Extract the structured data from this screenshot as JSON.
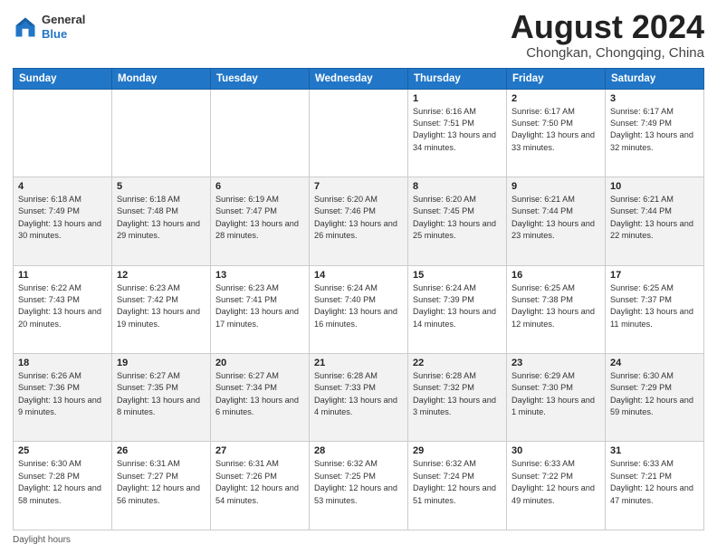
{
  "header": {
    "logo_general": "General",
    "logo_blue": "Blue",
    "month_title": "August 2024",
    "location": "Chongkan, Chongqing, China"
  },
  "days_of_week": [
    "Sunday",
    "Monday",
    "Tuesday",
    "Wednesday",
    "Thursday",
    "Friday",
    "Saturday"
  ],
  "weeks": [
    [
      {
        "day": "",
        "info": ""
      },
      {
        "day": "",
        "info": ""
      },
      {
        "day": "",
        "info": ""
      },
      {
        "day": "",
        "info": ""
      },
      {
        "day": "1",
        "info": "Sunrise: 6:16 AM\nSunset: 7:51 PM\nDaylight: 13 hours and 34 minutes."
      },
      {
        "day": "2",
        "info": "Sunrise: 6:17 AM\nSunset: 7:50 PM\nDaylight: 13 hours and 33 minutes."
      },
      {
        "day": "3",
        "info": "Sunrise: 6:17 AM\nSunset: 7:49 PM\nDaylight: 13 hours and 32 minutes."
      }
    ],
    [
      {
        "day": "4",
        "info": "Sunrise: 6:18 AM\nSunset: 7:49 PM\nDaylight: 13 hours and 30 minutes."
      },
      {
        "day": "5",
        "info": "Sunrise: 6:18 AM\nSunset: 7:48 PM\nDaylight: 13 hours and 29 minutes."
      },
      {
        "day": "6",
        "info": "Sunrise: 6:19 AM\nSunset: 7:47 PM\nDaylight: 13 hours and 28 minutes."
      },
      {
        "day": "7",
        "info": "Sunrise: 6:20 AM\nSunset: 7:46 PM\nDaylight: 13 hours and 26 minutes."
      },
      {
        "day": "8",
        "info": "Sunrise: 6:20 AM\nSunset: 7:45 PM\nDaylight: 13 hours and 25 minutes."
      },
      {
        "day": "9",
        "info": "Sunrise: 6:21 AM\nSunset: 7:44 PM\nDaylight: 13 hours and 23 minutes."
      },
      {
        "day": "10",
        "info": "Sunrise: 6:21 AM\nSunset: 7:44 PM\nDaylight: 13 hours and 22 minutes."
      }
    ],
    [
      {
        "day": "11",
        "info": "Sunrise: 6:22 AM\nSunset: 7:43 PM\nDaylight: 13 hours and 20 minutes."
      },
      {
        "day": "12",
        "info": "Sunrise: 6:23 AM\nSunset: 7:42 PM\nDaylight: 13 hours and 19 minutes."
      },
      {
        "day": "13",
        "info": "Sunrise: 6:23 AM\nSunset: 7:41 PM\nDaylight: 13 hours and 17 minutes."
      },
      {
        "day": "14",
        "info": "Sunrise: 6:24 AM\nSunset: 7:40 PM\nDaylight: 13 hours and 16 minutes."
      },
      {
        "day": "15",
        "info": "Sunrise: 6:24 AM\nSunset: 7:39 PM\nDaylight: 13 hours and 14 minutes."
      },
      {
        "day": "16",
        "info": "Sunrise: 6:25 AM\nSunset: 7:38 PM\nDaylight: 13 hours and 12 minutes."
      },
      {
        "day": "17",
        "info": "Sunrise: 6:25 AM\nSunset: 7:37 PM\nDaylight: 13 hours and 11 minutes."
      }
    ],
    [
      {
        "day": "18",
        "info": "Sunrise: 6:26 AM\nSunset: 7:36 PM\nDaylight: 13 hours and 9 minutes."
      },
      {
        "day": "19",
        "info": "Sunrise: 6:27 AM\nSunset: 7:35 PM\nDaylight: 13 hours and 8 minutes."
      },
      {
        "day": "20",
        "info": "Sunrise: 6:27 AM\nSunset: 7:34 PM\nDaylight: 13 hours and 6 minutes."
      },
      {
        "day": "21",
        "info": "Sunrise: 6:28 AM\nSunset: 7:33 PM\nDaylight: 13 hours and 4 minutes."
      },
      {
        "day": "22",
        "info": "Sunrise: 6:28 AM\nSunset: 7:32 PM\nDaylight: 13 hours and 3 minutes."
      },
      {
        "day": "23",
        "info": "Sunrise: 6:29 AM\nSunset: 7:30 PM\nDaylight: 13 hours and 1 minute."
      },
      {
        "day": "24",
        "info": "Sunrise: 6:30 AM\nSunset: 7:29 PM\nDaylight: 12 hours and 59 minutes."
      }
    ],
    [
      {
        "day": "25",
        "info": "Sunrise: 6:30 AM\nSunset: 7:28 PM\nDaylight: 12 hours and 58 minutes."
      },
      {
        "day": "26",
        "info": "Sunrise: 6:31 AM\nSunset: 7:27 PM\nDaylight: 12 hours and 56 minutes."
      },
      {
        "day": "27",
        "info": "Sunrise: 6:31 AM\nSunset: 7:26 PM\nDaylight: 12 hours and 54 minutes."
      },
      {
        "day": "28",
        "info": "Sunrise: 6:32 AM\nSunset: 7:25 PM\nDaylight: 12 hours and 53 minutes."
      },
      {
        "day": "29",
        "info": "Sunrise: 6:32 AM\nSunset: 7:24 PM\nDaylight: 12 hours and 51 minutes."
      },
      {
        "day": "30",
        "info": "Sunrise: 6:33 AM\nSunset: 7:22 PM\nDaylight: 12 hours and 49 minutes."
      },
      {
        "day": "31",
        "info": "Sunrise: 6:33 AM\nSunset: 7:21 PM\nDaylight: 12 hours and 47 minutes."
      }
    ]
  ],
  "footer": {
    "daylight_hours": "Daylight hours"
  }
}
